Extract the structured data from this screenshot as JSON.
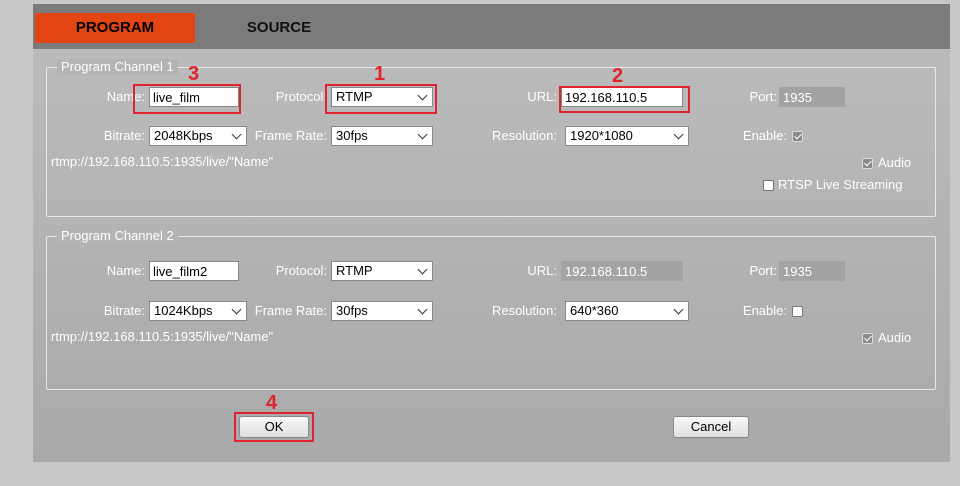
{
  "tabs": {
    "program": "PROGRAM",
    "source": "SOURCE"
  },
  "labels": {
    "name": "Name:",
    "protocol": "Protocol:",
    "url": "URL:",
    "port": "Port:",
    "bitrate": "Bitrate:",
    "frame_rate": "Frame Rate:",
    "resolution": "Resolution:",
    "enable": "Enable:",
    "audio": "Audio",
    "rtsp": "RTSP Live Streaming"
  },
  "channel1": {
    "legend": "Program Channel 1",
    "name": "live_film",
    "protocol": "RTMP",
    "url": "192.168.110.5",
    "port": "1935",
    "bitrate": "2048Kbps",
    "frame_rate": "30fps",
    "resolution": "1920*1080",
    "enable": true,
    "audio": true,
    "rtsp": false,
    "stream_url": "rtmp://192.168.110.5:1935/live/\"Name\""
  },
  "channel2": {
    "legend": "Program Channel 2",
    "name": "live_film2",
    "protocol": "RTMP",
    "url": "192.168.110.5",
    "port": "1935",
    "bitrate": "1024Kbps",
    "frame_rate": "30fps",
    "resolution": "640*360",
    "enable": false,
    "audio": true,
    "stream_url": "rtmp://192.168.110.5:1935/live/\"Name\""
  },
  "buttons": {
    "ok": "OK",
    "cancel": "Cancel"
  },
  "annotations": {
    "n1": "1",
    "n2": "2",
    "n3": "3",
    "n4": "4"
  },
  "colors": {
    "active_tab": "#e24412",
    "highlight": "#e0232f"
  }
}
